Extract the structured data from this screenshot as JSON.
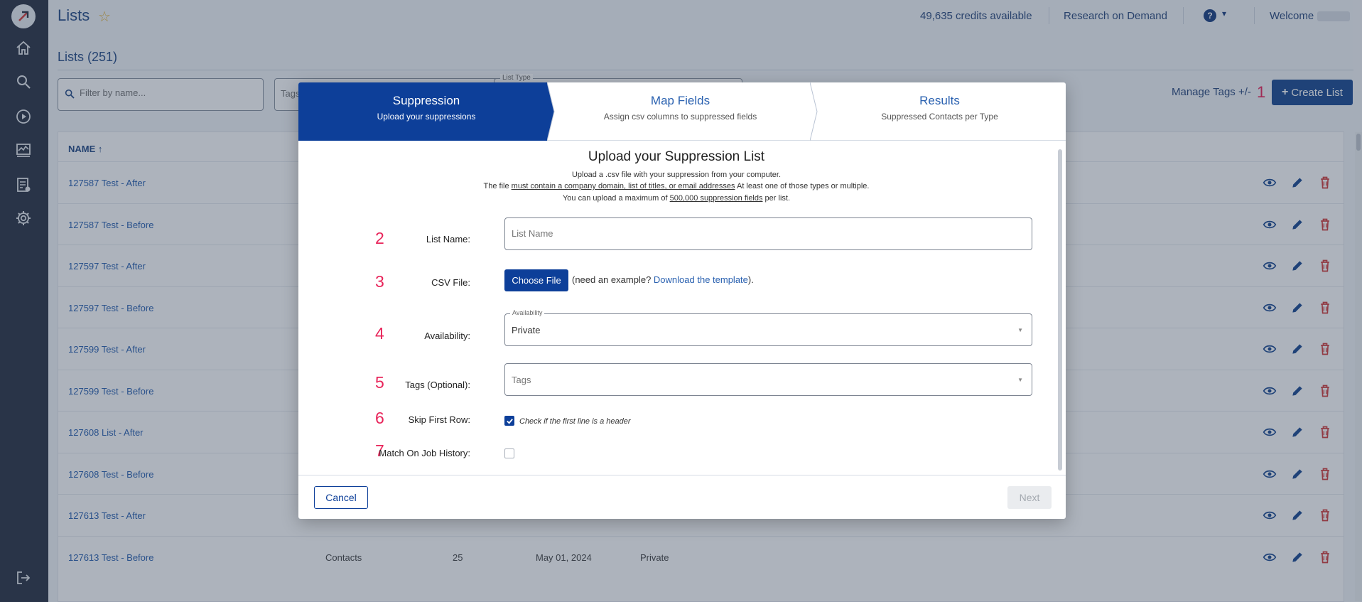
{
  "header": {
    "title": "Lists",
    "credits": "49,635 credits available",
    "research_link": "Research on Demand",
    "welcome": "Welcome"
  },
  "lists": {
    "heading": "Lists (251)",
    "filter_placeholder": "Filter by name...",
    "tags_placeholder": "Tags",
    "list_type_label": "List Type",
    "manage_tags": "Manage Tags +/-",
    "manage_tags_callout": "1",
    "create_list": "Create List",
    "column_name": "NAME",
    "rows": [
      {
        "name": "127587 Test - After"
      },
      {
        "name": "127587 Test - Before"
      },
      {
        "name": "127597 Test - After"
      },
      {
        "name": "127597 Test - Before"
      },
      {
        "name": "127599 Test - After"
      },
      {
        "name": "127599 Test - Before"
      },
      {
        "name": "127608 List - After"
      },
      {
        "name": "127608 Test - Before"
      },
      {
        "name": "127613 Test - After"
      },
      {
        "name": "127613 Test - Before",
        "type": "Contacts",
        "count": "25",
        "date": "May 01, 2024",
        "availability": "Private"
      }
    ]
  },
  "modal": {
    "steps": [
      {
        "title": "Suppression",
        "subtitle": "Upload your suppressions"
      },
      {
        "title": "Map Fields",
        "subtitle": "Assign csv columns to suppressed fields"
      },
      {
        "title": "Results",
        "subtitle": "Suppressed Contacts per Type"
      }
    ],
    "form_title": "Upload your Suppression List",
    "desc_line1": "Upload a .csv file with your suppression from your computer.",
    "desc_line2_pre": "The file ",
    "desc_line2_u": "must contain a company domain, list of titles, or email addresses",
    "desc_line2_post": " At least one of those types or multiple.",
    "desc_line3_pre": "You can upload a maximum of ",
    "desc_line3_u": "500,000 suppression fields",
    "desc_line3_post": " per list.",
    "fields": {
      "list_name": {
        "num": "2",
        "label": "List Name:",
        "placeholder": "List Name"
      },
      "csv_file": {
        "num": "3",
        "label": "CSV File:",
        "button": "Choose File",
        "help_pre": "(need an example? ",
        "help_link": "Download the template",
        "help_post": ")."
      },
      "availability": {
        "num": "4",
        "label": "Availability:",
        "float_label": "Availability",
        "value": "Private"
      },
      "tags": {
        "num": "5",
        "label": "Tags (Optional):",
        "placeholder": "Tags"
      },
      "skip_first_row": {
        "num": "6",
        "label": "Skip First Row:",
        "hint": "Check if the first line is a header",
        "checked": true
      },
      "match_job_history": {
        "num": "7",
        "label": "Match On Job History:",
        "checked": false
      }
    },
    "cancel": "Cancel",
    "next": "Next"
  },
  "colors": {
    "primary": "#0d3f99",
    "callout": "#e8245a",
    "sidebar": "#2a3344",
    "link": "#2a61b0",
    "delete": "#d23c3c"
  }
}
